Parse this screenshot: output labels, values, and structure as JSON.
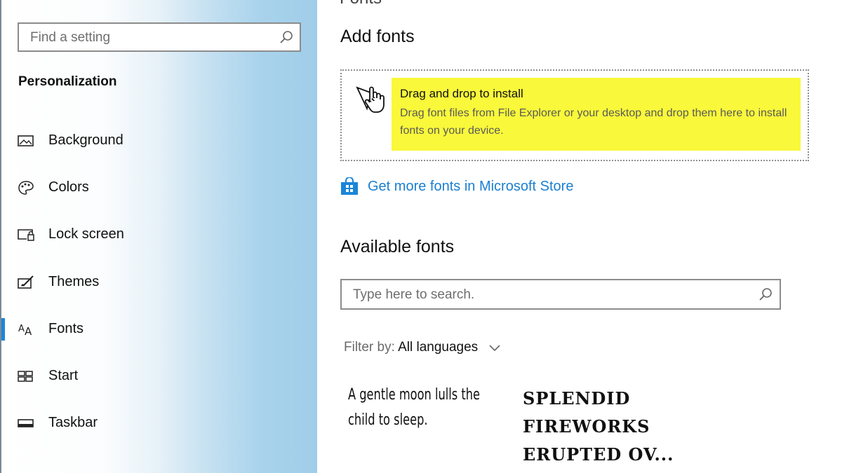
{
  "sidebar": {
    "search": {
      "placeholder": "Find a setting"
    },
    "section_title": "Personalization",
    "items": [
      {
        "label": "Background",
        "icon": "picture-icon"
      },
      {
        "label": "Colors",
        "icon": "palette-icon"
      },
      {
        "label": "Lock screen",
        "icon": "lock-screen-icon"
      },
      {
        "label": "Themes",
        "icon": "themes-icon"
      },
      {
        "label": "Fonts",
        "icon": "fonts-icon",
        "selected": true
      },
      {
        "label": "Start",
        "icon": "start-icon"
      },
      {
        "label": "Taskbar",
        "icon": "taskbar-icon"
      }
    ],
    "accent_color": "#1a86d8"
  },
  "main": {
    "page_title_cut": "Fonts",
    "add_fonts": {
      "heading": "Add fonts",
      "drop_title": "Drag and drop to install",
      "drop_description": "Drag font files from File Explorer or your desktop and drop them here to install fonts on your device.",
      "highlight_color": "#f9f83a"
    },
    "store_link": {
      "label": "Get more fonts in Microsoft Store",
      "icon": "store-bag-icon",
      "color": "#1a7fd0"
    },
    "available_fonts": {
      "heading": "Available fonts",
      "search_placeholder": "Type here to search.",
      "filter_label": "Filter by:",
      "filter_value": "All languages",
      "samples": [
        {
          "text": "A gentle moon lulls the child to sleep."
        },
        {
          "text": "SPLENDID FIREWORKS ERUPTED OV..."
        }
      ]
    }
  }
}
